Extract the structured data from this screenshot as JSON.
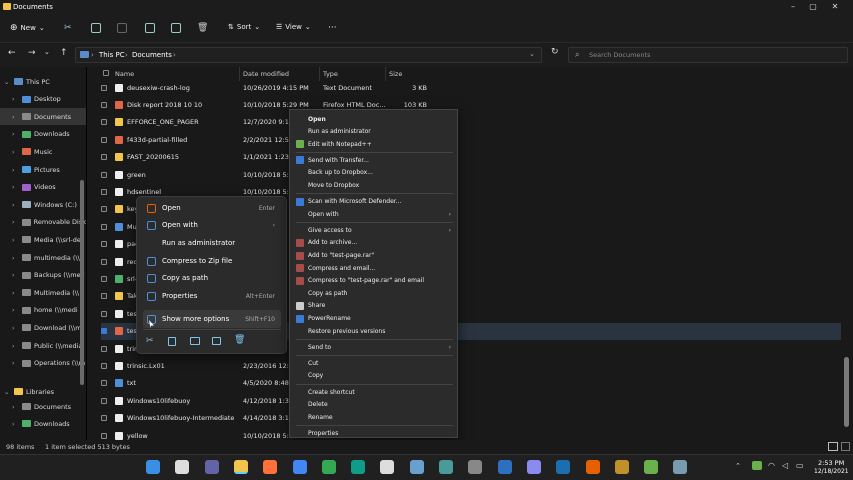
{
  "window": {
    "title": "Documents"
  },
  "commandbar": {
    "new_label": "New",
    "sort_label": "Sort",
    "view_label": "View",
    "more_label": "···"
  },
  "address": {
    "crumbs": [
      "This PC",
      "Documents"
    ],
    "search_placeholder": "Search Documents"
  },
  "columns": {
    "name": "Name",
    "date": "Date modified",
    "type": "Type",
    "size": "Size"
  },
  "sidebar": {
    "items": [
      {
        "label": "This PC",
        "indent": 0
      },
      {
        "label": "Desktop",
        "indent": 1
      },
      {
        "label": "Documents",
        "indent": 1
      },
      {
        "label": "Downloads",
        "indent": 1
      },
      {
        "label": "Music",
        "indent": 1
      },
      {
        "label": "Pictures",
        "indent": 1
      },
      {
        "label": "Videos",
        "indent": 1
      },
      {
        "label": "Windows (C:)",
        "indent": 1
      },
      {
        "label": "Removable Disk",
        "indent": 1
      },
      {
        "label": "Media (\\\\srl-del",
        "indent": 1
      },
      {
        "label": "multimedia (\\\\s",
        "indent": 1
      },
      {
        "label": "Backups (\\\\med",
        "indent": 1
      },
      {
        "label": "Multimedia (\\\\",
        "indent": 1
      },
      {
        "label": "home (\\\\medi",
        "indent": 1
      },
      {
        "label": "Download (\\\\m",
        "indent": 1
      },
      {
        "label": "Public (\\\\media",
        "indent": 1
      },
      {
        "label": "Operations (\\\\m",
        "indent": 1
      },
      {
        "label": "Libraries",
        "indent": 0
      },
      {
        "label": "Documents",
        "indent": 1
      },
      {
        "label": "Downloads",
        "indent": 1
      }
    ]
  },
  "files": [
    {
      "name": "deusexiw-crash-log",
      "date": "10/26/2019 4:15 PM",
      "type": "Text Document",
      "size": "3 KB"
    },
    {
      "name": "Disk report 2018 10 10",
      "date": "10/10/2018 5:29 PM",
      "type": "Firefox HTML Doc...",
      "size": "103 KB"
    },
    {
      "name": "EFFORCE_ONE_PAGER",
      "date": "12/7/2020 9:16",
      "type": "",
      "size": ""
    },
    {
      "name": "f433d-partial-filled",
      "date": "2/2/2021 12:50",
      "type": "",
      "size": ""
    },
    {
      "name": "FAST_20200615",
      "date": "1/1/2021 1:23 F",
      "type": "",
      "size": ""
    },
    {
      "name": "green",
      "date": "10/10/2018 5:2",
      "type": "",
      "size": ""
    },
    {
      "name": "hdsentinel",
      "date": "10/10/2018 5:2",
      "type": "",
      "size": ""
    },
    {
      "name": "key",
      "date": "",
      "type": "",
      "size": ""
    },
    {
      "name": "Mu",
      "date": "",
      "type": "",
      "size": ""
    },
    {
      "name": "pac",
      "date": "",
      "type": "",
      "size": ""
    },
    {
      "name": "red",
      "date": "",
      "type": "",
      "size": ""
    },
    {
      "name": "srl-",
      "date": "",
      "type": "",
      "size": ""
    },
    {
      "name": "Tak",
      "date": "",
      "type": "",
      "size": ""
    },
    {
      "name": "test",
      "date": "",
      "type": "",
      "size": ""
    },
    {
      "name": "test",
      "date": "",
      "type": "",
      "size": ""
    },
    {
      "name": "trin",
      "date": "",
      "type": "",
      "size": ""
    },
    {
      "name": "trinsic.Lx01",
      "date": "2/23/2016 12:2",
      "type": "",
      "size": ""
    },
    {
      "name": "txt",
      "date": "4/5/2020 8:48 A",
      "type": "",
      "size": ""
    },
    {
      "name": "Windows10lifebuoy",
      "date": "4/12/2018 1:3",
      "type": "",
      "size": ""
    },
    {
      "name": "Windows10lifebuoy-Intermediate",
      "date": "4/14/2018 3:1",
      "type": "",
      "size": ""
    },
    {
      "name": "yellow",
      "date": "10/10/2018 5:2",
      "type": "",
      "size": ""
    }
  ],
  "context_menu": {
    "items": [
      {
        "label": "Open",
        "shortcut": "Enter"
      },
      {
        "label": "Open with",
        "shortcut": "›"
      },
      {
        "label": "Run as administrator",
        "shortcut": ""
      },
      {
        "label": "Compress to Zip file",
        "shortcut": ""
      },
      {
        "label": "Copy as path",
        "shortcut": ""
      },
      {
        "label": "Properties",
        "shortcut": "Alt+Enter"
      },
      {
        "label": "Show more options",
        "shortcut": "Shift+F10"
      }
    ]
  },
  "classic_menu": {
    "items": [
      {
        "label": "Open",
        "bold": true,
        "arrow": false,
        "sep_after": false
      },
      {
        "label": "Run as administrator",
        "arrow": false,
        "sep_after": false
      },
      {
        "label": "Edit with Notepad++",
        "arrow": false,
        "sep_after": true
      },
      {
        "label": "Send with Transfer...",
        "arrow": false,
        "sep_after": false
      },
      {
        "label": "Back up to Dropbox...",
        "arrow": false,
        "sep_after": false
      },
      {
        "label": "Move to Dropbox",
        "arrow": false,
        "sep_after": true
      },
      {
        "label": "Scan with Microsoft Defender...",
        "arrow": false,
        "sep_after": false
      },
      {
        "label": "Open with",
        "arrow": true,
        "sep_after": true
      },
      {
        "label": "Give access to",
        "arrow": true,
        "sep_after": false
      },
      {
        "label": "Add to archive...",
        "arrow": false,
        "sep_after": false
      },
      {
        "label": "Add to \"test-page.rar\"",
        "arrow": false,
        "sep_after": false
      },
      {
        "label": "Compress and email...",
        "arrow": false,
        "sep_after": false
      },
      {
        "label": "Compress to \"test-page.rar\" and email",
        "arrow": false,
        "sep_after": false
      },
      {
        "label": "Copy as path",
        "arrow": false,
        "sep_after": false
      },
      {
        "label": "Share",
        "arrow": false,
        "sep_after": false
      },
      {
        "label": "PowerRename",
        "arrow": false,
        "sep_after": false
      },
      {
        "label": "Restore previous versions",
        "arrow": false,
        "sep_after": true
      },
      {
        "label": "Send to",
        "arrow": true,
        "sep_after": true
      },
      {
        "label": "Cut",
        "arrow": false,
        "sep_after": false
      },
      {
        "label": "Copy",
        "arrow": false,
        "sep_after": true
      },
      {
        "label": "Create shortcut",
        "arrow": false,
        "sep_after": false
      },
      {
        "label": "Delete",
        "arrow": false,
        "sep_after": false
      },
      {
        "label": "Rename",
        "arrow": false,
        "sep_after": true
      },
      {
        "label": "Properties",
        "arrow": false,
        "sep_after": false
      }
    ]
  },
  "status": {
    "count": "98 items",
    "selected": "1 item selected  513 bytes"
  },
  "clock": {
    "time": "2:53 PM",
    "date": "12/18/2021"
  },
  "colors": {
    "accent": "#60cdff",
    "folder": "#f3c54d",
    "bg": "#191919"
  }
}
